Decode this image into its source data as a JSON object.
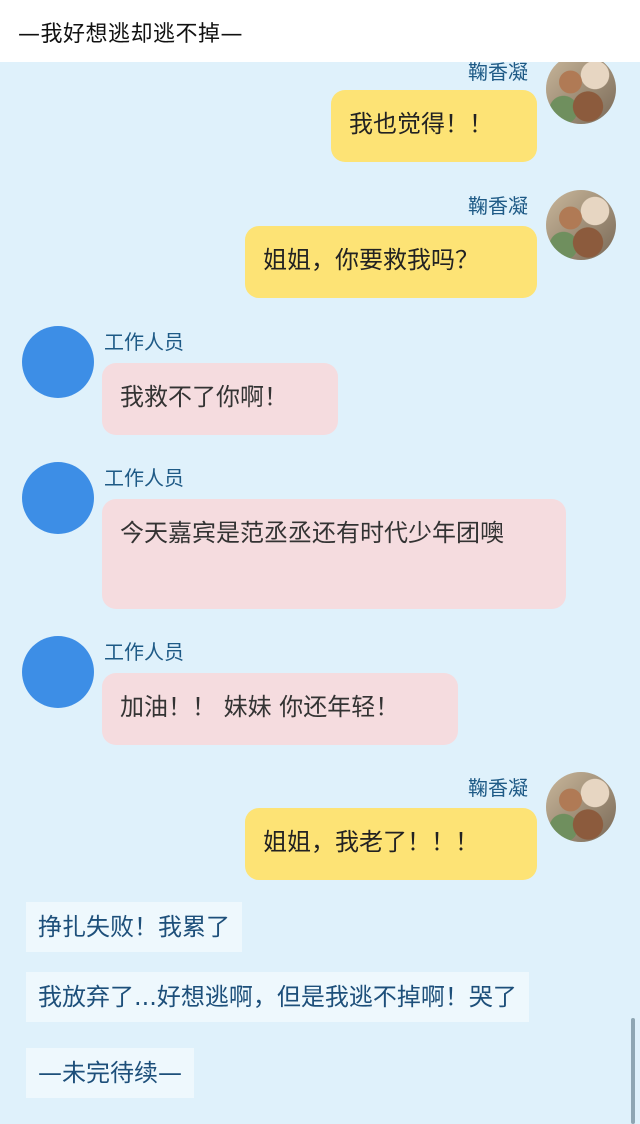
{
  "header": {
    "title": "—我好想逃却逃不掉—"
  },
  "messages": [
    {
      "sender": "鞠香凝",
      "text": "我也觉得！！"
    },
    {
      "sender": "鞠香凝",
      "text": "姐姐，你要救我吗？"
    },
    {
      "sender": "工作人员",
      "text": "我救不了你啊！"
    },
    {
      "sender": "工作人员",
      "text": "今天嘉宾是范丞丞还有时代少年团噢"
    },
    {
      "sender": "工作人员",
      "text": "加油！！ 妹妹 你还年轻！"
    },
    {
      "sender": "鞠香凝",
      "text": "姐姐，我老了！！！"
    }
  ],
  "narration": [
    "挣扎失败！我累了",
    "我放弃了...好想逃啊，但是我逃不掉啊！哭了",
    "—未完待续—"
  ],
  "colors": {
    "chat_bg": "#dff1fb",
    "self_bubble": "#fde375",
    "other_bubble": "#f5dcdf",
    "name_text": "#1e5a86",
    "narration_text": "#1d4f7a",
    "staff_avatar": "#3d8ee6"
  }
}
